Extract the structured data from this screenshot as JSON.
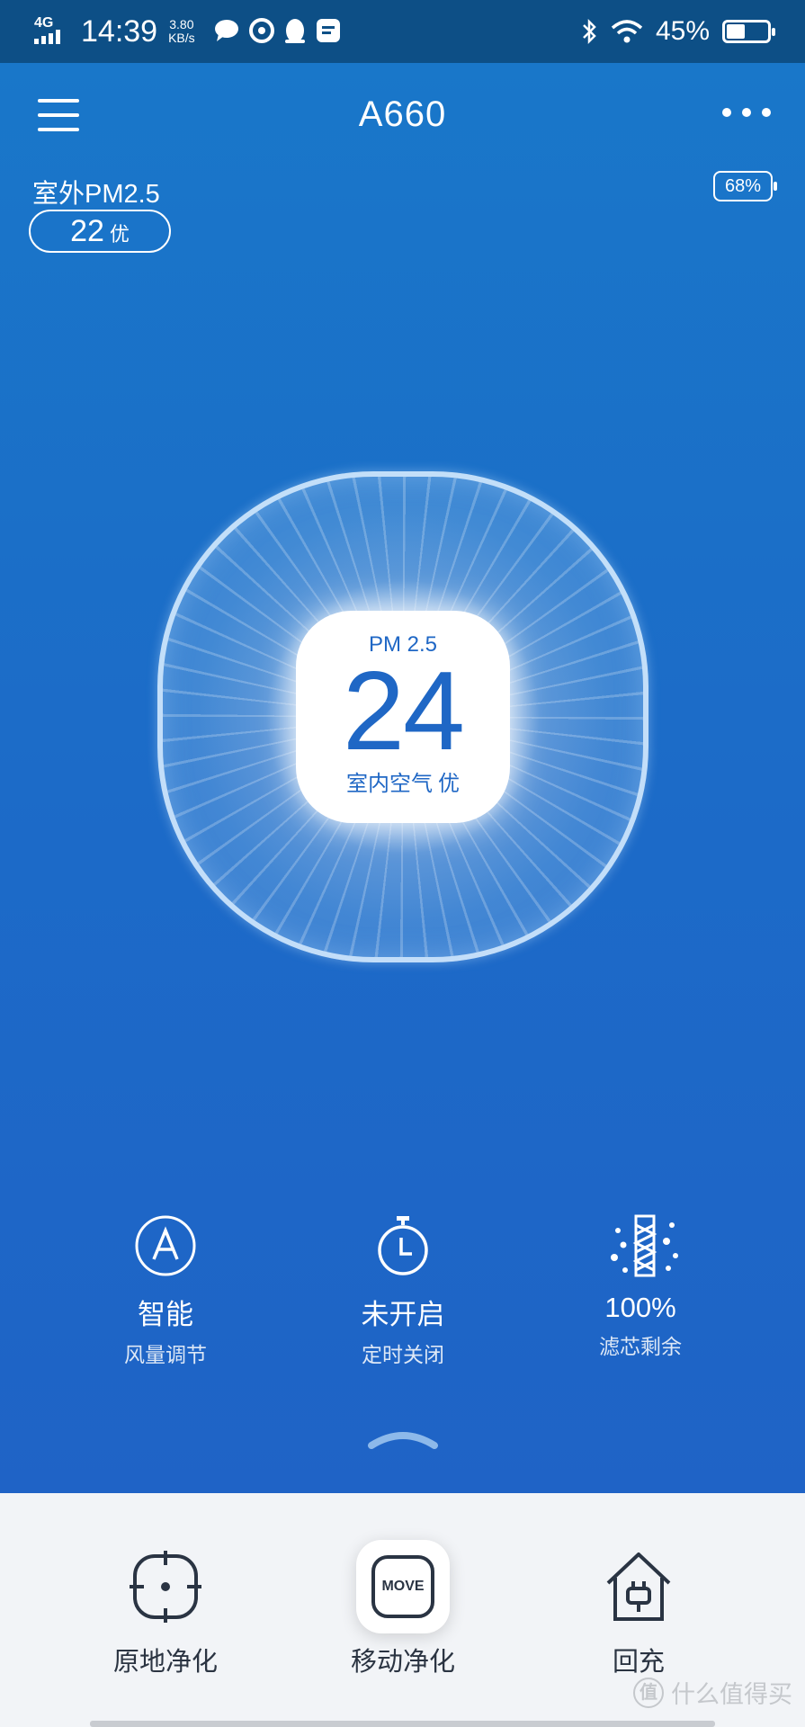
{
  "status_bar": {
    "network": "4G",
    "time": "14:39",
    "speed_value": "3.80",
    "speed_unit": "KB/s",
    "notification_icons": [
      "chat-bubble-icon",
      "sync-icon",
      "qq-penguin-icon",
      "log-app-icon"
    ],
    "battery_percent": "45%",
    "battery_level": 0.45
  },
  "header": {
    "title": "A660"
  },
  "outdoor": {
    "label": "室外PM2.5",
    "value": "22",
    "quality": "优"
  },
  "device_battery": "68%",
  "reading": {
    "label": "PM 2.5",
    "value": "24",
    "text": "室内空气",
    "quality": "优"
  },
  "stats": [
    {
      "icon": "auto-mode-icon",
      "value": "智能",
      "label": "风量调节"
    },
    {
      "icon": "timer-icon",
      "value": "未开启",
      "label": "定时关闭"
    },
    {
      "icon": "filter-icon",
      "value": "100%",
      "label": "滤芯剩余"
    }
  ],
  "bottom_actions": [
    {
      "icon": "crosshair-icon",
      "label": "原地净化"
    },
    {
      "icon": "move-icon",
      "icon_text": "MOVE",
      "label": "移动净化"
    },
    {
      "icon": "home-charge-icon",
      "label": "回充"
    }
  ],
  "watermark": {
    "badge": "值",
    "text": "什么值得买"
  },
  "colors": {
    "primary_blue": "#1c6bc8",
    "statusbar": "#0d4f86",
    "reading_text": "#1f67c5",
    "bottom_bg": "#f2f4f7",
    "icon_dark": "#2a3443"
  }
}
